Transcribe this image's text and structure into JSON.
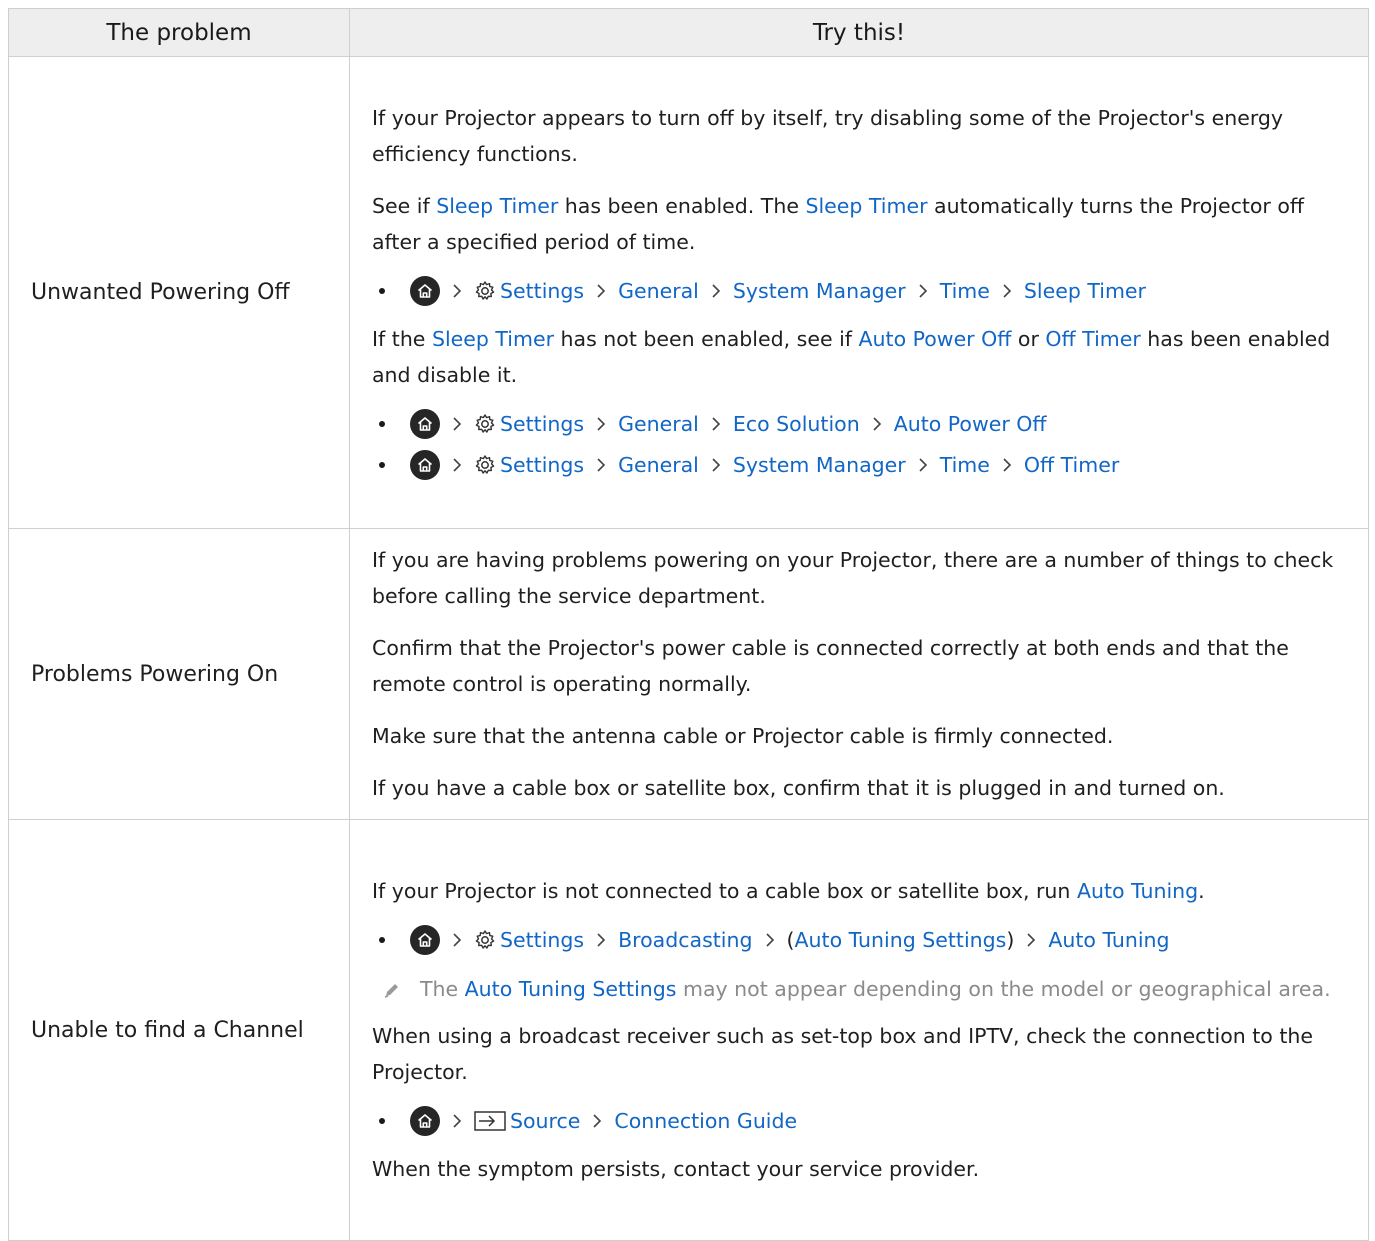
{
  "header": {
    "col1": "The problem",
    "col2": "Try this!"
  },
  "rows": [
    {
      "problem": "Unwanted Powering Off",
      "p1": "If your Projector appears to turn off by itself, try disabling some of the Projector's energy efficiency functions.",
      "p2": {
        "t1": "See if ",
        "l1": "Sleep Timer",
        "t2": " has been enabled. The ",
        "l2": "Sleep Timer",
        "t3": " automatically turns the Projector off after a specified period of time."
      },
      "path1": [
        "Settings",
        "General",
        "System Manager",
        "Time",
        "Sleep Timer"
      ],
      "p3": {
        "t1": "If the ",
        "l1": "Sleep Timer",
        "t2": " has not been enabled, see if ",
        "l2": "Auto Power Off",
        "t3": " or ",
        "l3": "Off Timer",
        "t4": " has been enabled and disable it."
      },
      "path2": [
        "Settings",
        "General",
        "Eco Solution",
        "Auto Power Off"
      ],
      "path3": [
        "Settings",
        "General",
        "System Manager",
        "Time",
        "Off Timer"
      ]
    },
    {
      "problem": "Problems Powering On",
      "p1": "If you are having problems powering on your Projector, there are a number of things to check before calling the service department.",
      "p2": "Confirm that the Projector's power cable is connected correctly at both ends and that the remote control is operating normally.",
      "p3": "Make sure that the antenna cable or Projector cable is firmly connected.",
      "p4": "If you have a cable box or satellite box, confirm that it is plugged in and turned on."
    },
    {
      "problem": "Unable to find a Channel",
      "p1": {
        "t1": "If your Projector is not connected to a cable box or satellite box, run ",
        "l1": "Auto Tuning",
        "t2": "."
      },
      "path1": {
        "settings": "Settings",
        "broadcasting": "Broadcasting",
        "open": "(",
        "ats": "Auto Tuning Settings",
        "close": ")",
        "auto": "Auto Tuning"
      },
      "note": {
        "t1": "The ",
        "l1": "Auto Tuning Settings",
        "t2": " may not appear depending on the model or geographical area."
      },
      "p2": "When using a broadcast receiver such as set-top box and IPTV, check the connection to the Projector.",
      "path2": [
        "Source",
        "Connection Guide"
      ],
      "p3": "When the symptom persists, contact your service provider."
    }
  ],
  "colors": {
    "link": "#1166c6",
    "header_bg": "#eeeeee",
    "border": "#cfcfcf",
    "note_text": "#8a8a8a"
  },
  "icons": [
    "home-icon",
    "gear-icon",
    "chevron-right-icon",
    "source-icon",
    "pencil-icon",
    "bullet-dot"
  ]
}
